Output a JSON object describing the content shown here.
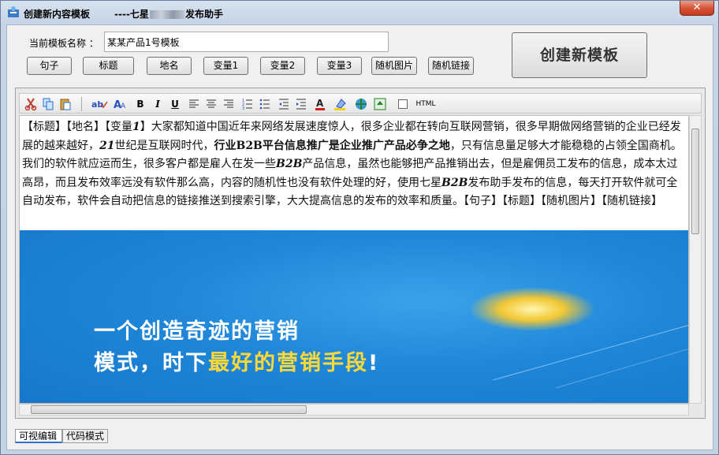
{
  "window": {
    "title": "创建新内容模板",
    "subtitle_prefix": "----七星",
    "subtitle_suffix": "发布助手",
    "close_label": "✕"
  },
  "form": {
    "template_label": "当前模板名称 ：",
    "template_value": "某某产品1号模板"
  },
  "buttons": [
    {
      "label": "句子"
    },
    {
      "label": "标题"
    },
    {
      "label": "地名"
    },
    {
      "label": "变量1"
    },
    {
      "label": "变量2"
    },
    {
      "label": "变量3"
    },
    {
      "label": "随机图片"
    },
    {
      "label": "随机链接"
    }
  ],
  "create_button": "创建新模板",
  "toolbar": {
    "html_label": "HTML",
    "icons": [
      "cut-icon",
      "copy-icon",
      "paste-icon",
      "spellcheck-icon",
      "font-size-icon",
      "bold-icon",
      "italic-icon",
      "underline-icon",
      "align-left-icon",
      "align-center-icon",
      "align-right-icon",
      "ordered-list-icon",
      "unordered-list-icon",
      "outdent-icon",
      "indent-icon",
      "font-color-icon",
      "highlight-icon",
      "insert-link-icon",
      "insert-image-icon"
    ],
    "bold": "B",
    "italic": "I",
    "underline": "U"
  },
  "editor": {
    "p1": "【标题】【地名】【变量",
    "p1_italic": "1",
    "p2": "】大家都知道中国近年来网络发展速度惊人，很多企业都在转向互联网营销，很多早期做网络营销的企业已经发展的越来越好，",
    "p2_italic": "21",
    "p3": "世纪是互联网时代，",
    "p3_bold": "行业B2B平台信息推广是企业推广产品必争之地",
    "p4": "，只有信息量足够大才能稳稳的占领全国商机。我们的软件就应运而生，很多客户都是雇人在发一些",
    "p4_italic": "B2B",
    "p5": "产品信息，虽然也能够把产品推销出去，但是雇佣员工发布的信息，成本太过高昂，而且发布效率远没有软件那么高，内容的随机性也没有软件处理的好，使用七星",
    "p5_italic": "B2B",
    "p6": "发布助手发布的信息，每天打开软件就可全自动发布，软件会自动把信息的链接推送到搜索引擎，大大提高信息的发布的效率和质量。【句子】【标题】【随机图片】【随机链接】"
  },
  "banner": {
    "line1": "一个创造奇迹的营销",
    "line2_a": "模式，时下",
    "line2_b": "最好的营销手段",
    "line2_c": "!"
  },
  "tabs": [
    {
      "label": "可视编辑"
    },
    {
      "label": "代码模式"
    }
  ],
  "colors": {
    "banner_blue": "#1f86d8",
    "highlight_yellow": "#ffd93a",
    "close_red": "#d7573b"
  }
}
